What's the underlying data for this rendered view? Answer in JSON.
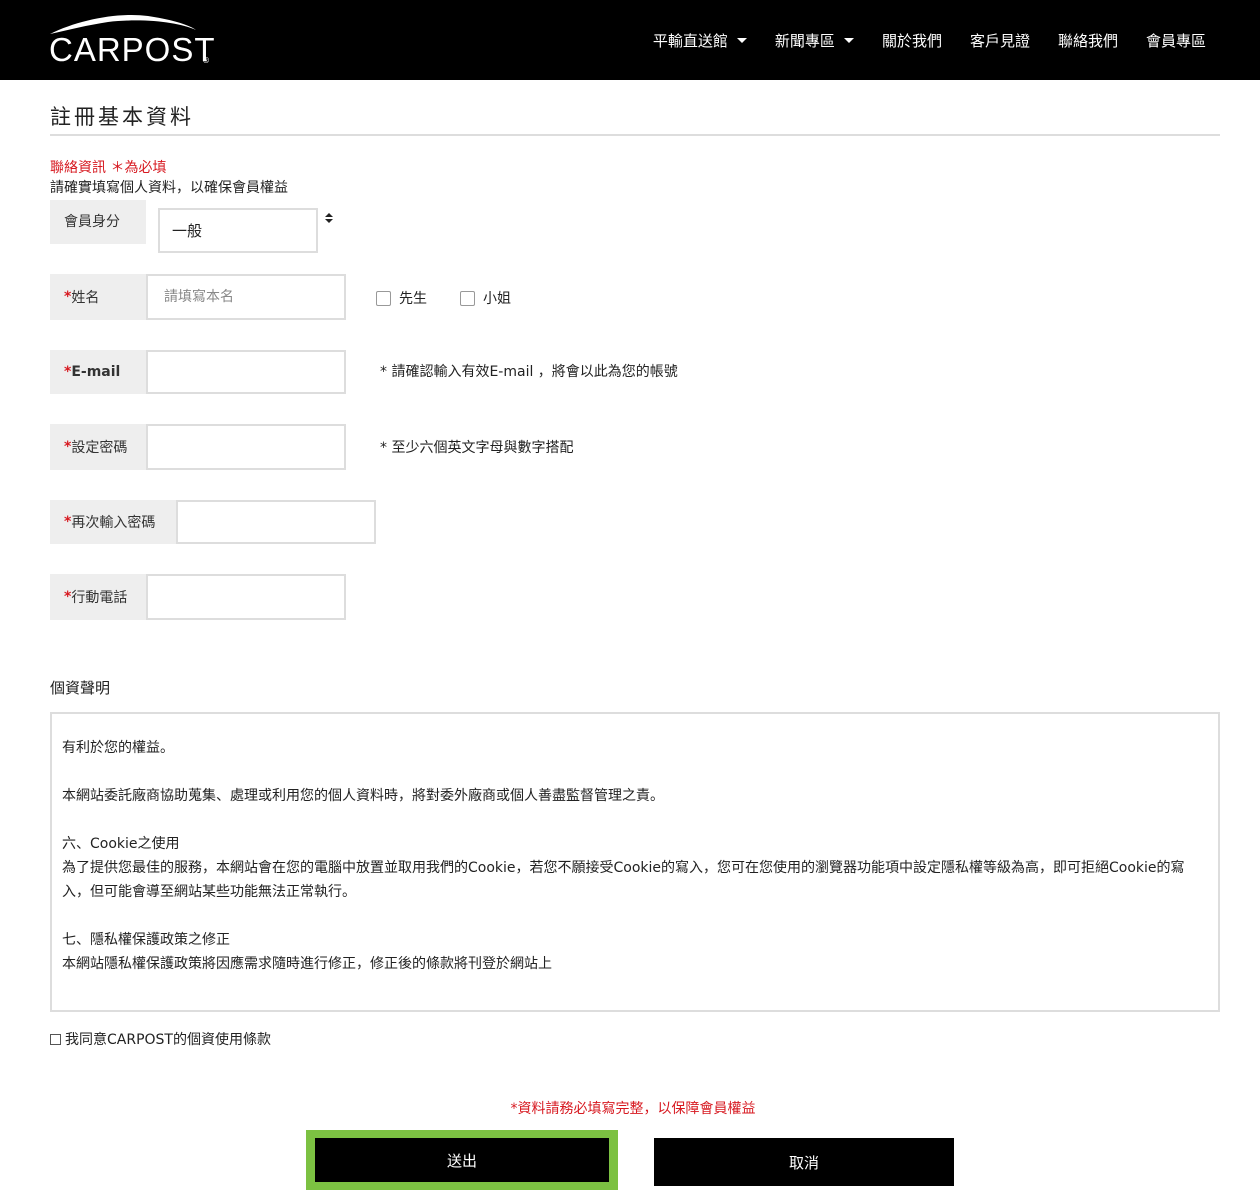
{
  "header": {
    "logo_text": "CARPOST",
    "logo_mark": "®",
    "menu": [
      {
        "label": "平輸直送館",
        "dropdown": true
      },
      {
        "label": "新聞專區",
        "dropdown": true
      },
      {
        "label": "關於我們",
        "dropdown": false
      },
      {
        "label": "客戶見證",
        "dropdown": false
      },
      {
        "label": "聯絡我們",
        "dropdown": false
      },
      {
        "label": "會員專區",
        "dropdown": false
      }
    ]
  },
  "form": {
    "title": "註冊基本資料",
    "contact_required": "聯絡資訊 ＊為必填",
    "contact_note": "請確實填寫個人資料，以確保會員權益",
    "member_type": {
      "label": "會員身分",
      "value": "一般"
    },
    "name": {
      "star": "*",
      "label": "姓名",
      "placeholder": "請填寫本名",
      "value": "",
      "option_mr": "先生",
      "option_ms": "小姐"
    },
    "email": {
      "star": "*",
      "label": "E-mail",
      "value": "",
      "hint": "* 請確認輸入有效E-mail ，將會以此為您的帳號"
    },
    "password": {
      "star": "*",
      "label": "設定密碼",
      "value": "",
      "hint": "* 至少六個英文字母與數字搭配"
    },
    "password_confirm": {
      "star": "*",
      "label": "再次輸入密碼",
      "value": ""
    },
    "mobile": {
      "star": "*",
      "label": "行動電話",
      "value": ""
    }
  },
  "privacy": {
    "title": "個資聲明",
    "paragraphs": [
      {
        "lines": [
          "有利於您的權益。"
        ]
      },
      {
        "lines": [
          "本網站委託廠商協助蒐集、處理或利用您的個人資料時，將對委外廠商或個人善盡監督管理之責。"
        ]
      },
      {
        "lines": [
          "六、Cookie之使用",
          "為了提供您最佳的服務，本網站會在您的電腦中放置並取用我們的Cookie，若您不願接受Cookie的寫入，您可在您使用的瀏覽器功能項中設定隱私權等級為高，即可拒絕Cookie的寫入，但可能會導至網站某些功能無法正常執行。"
        ]
      },
      {
        "lines": [
          "七、隱私權保護政策之修正",
          "本網站隱私權保護政策將因應需求隨時進行修正，修正後的條款將刊登於網站上"
        ]
      }
    ],
    "agree_label": "我同意CARPOST的個資使用條款"
  },
  "footer": {
    "note": "*資料請務必填寫完整，以保障會員權益",
    "submit_label": "送出",
    "cancel_label": "取消"
  },
  "colors": {
    "nav_bg": "#000000",
    "required_red": "#d71920",
    "focus_green": "#7cc142",
    "label_bg": "#eeeeee"
  }
}
